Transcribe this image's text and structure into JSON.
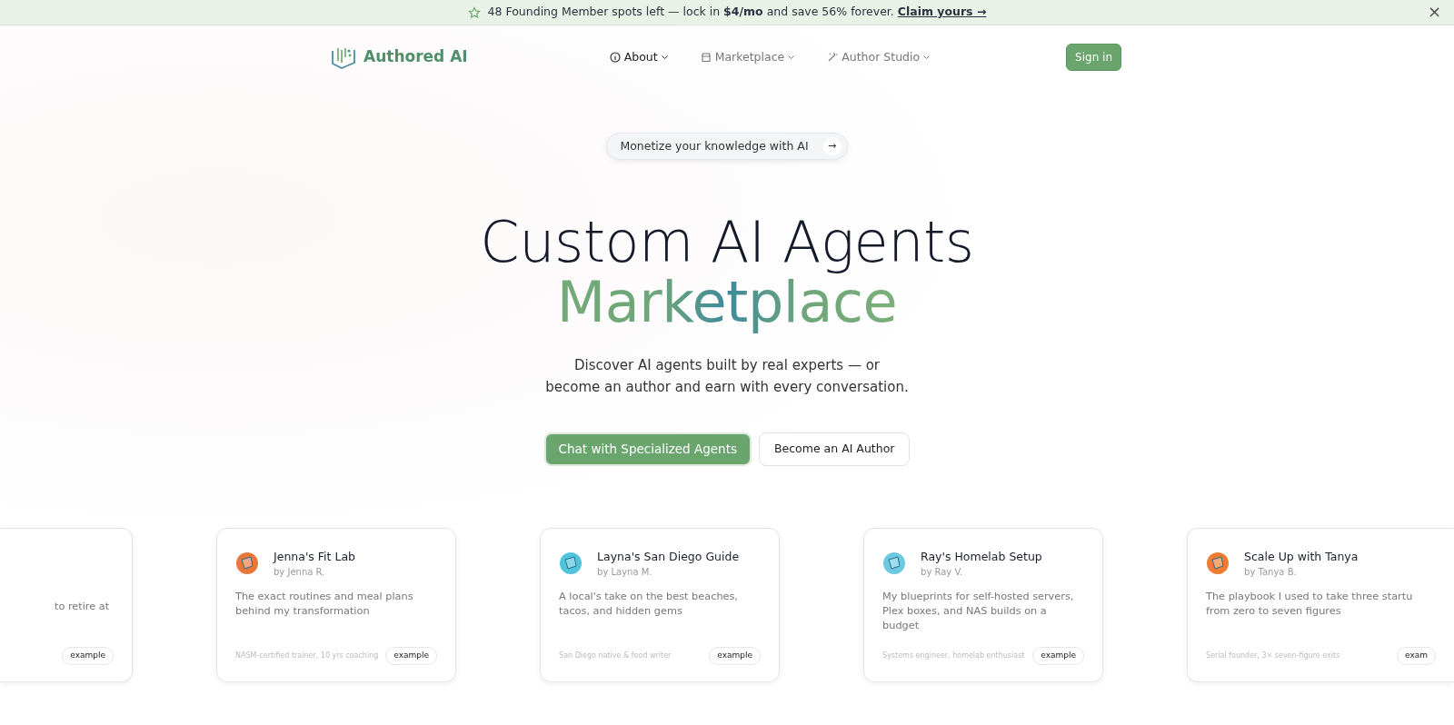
{
  "announcement": {
    "text": "48 Founding Member spots left — lock in **$4/mo** and save 56% forever.",
    "link": "Claim yours →",
    "close": "×"
  },
  "navbar": {
    "brand": "Authored AI",
    "items": [
      {
        "label": "About",
        "active": true
      },
      {
        "label": "Marketplace",
        "active": false
      },
      {
        "label": "Author Studio",
        "active": false
      }
    ],
    "sign_in": "Sign in"
  },
  "hero": {
    "pill": "Monetize your knowledge with AI",
    "pill_arrow": "→",
    "title": "Custom AI Agents",
    "title_accent": "Marketplace",
    "subtitle_lines": [
      "Discover AI agents built by real experts — or",
      "become an author and earn with every conversation."
    ],
    "buttons": [
      {
        "label": "Chat with Specialized Agents",
        "kind": "primary"
      },
      {
        "label": "Become an AI Author",
        "kind": "outline"
      }
    ]
  },
  "agents": [
    {
      "kind": "partial-left",
      "description": "to retire at",
      "tag": "example"
    },
    {
      "kind": "full",
      "title": "Jenna's Fit Lab",
      "author": "by Jenna R.",
      "description": "The exact routines and meal plans behind my transformation",
      "credential": "NASM-certified trainer, 10 yrs coaching",
      "tag": "example"
    },
    {
      "kind": "full",
      "title": "Layna's San Diego Guide",
      "author": "by Layna M.",
      "description": "A local's take on the best beaches, tacos, and hidden gems",
      "credential": "San Diego native & food writer",
      "tag": "example"
    },
    {
      "kind": "full",
      "title": "Ray's Homelab Setup",
      "author": "by Ray V.",
      "description": "My blueprints for self-hosted servers, Plex boxes, and NAS builds on a budget",
      "credential": "Systems engineer, homelab enthusiast",
      "tag": "example"
    },
    {
      "kind": "partial-right",
      "title": "Scale Up with Tanya",
      "author": "by Tanya B.",
      "description": "The playbook I used to take three startu from zero to seven figures",
      "credential": "Serial founder, 3× seven-figure exits",
      "tag": "exam"
    }
  ]
}
